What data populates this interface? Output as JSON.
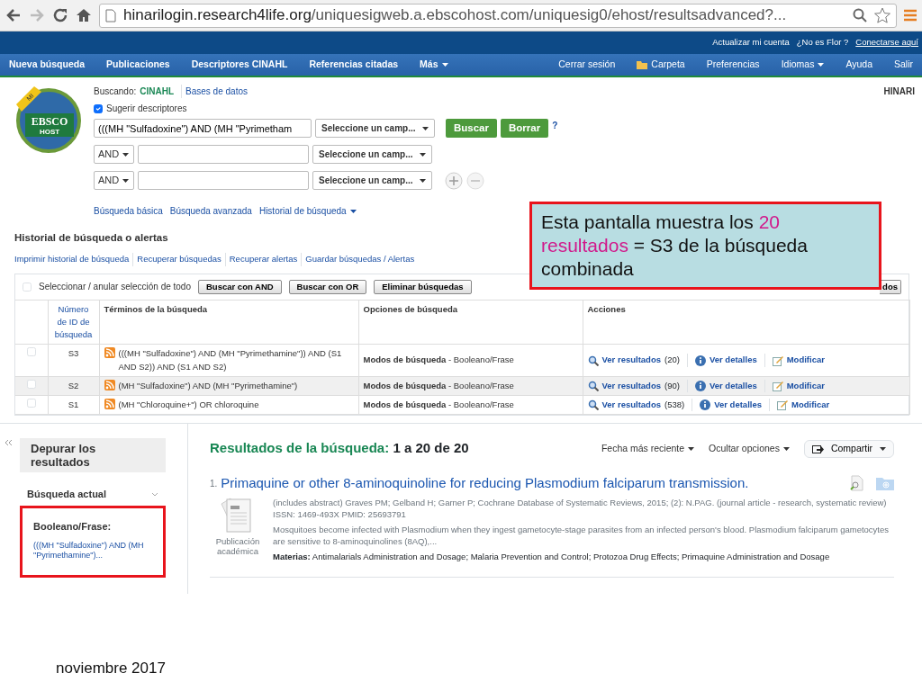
{
  "browser": {
    "url_host": "hinarilogin.research4life.org",
    "url_path": "/uniquesigweb.a.ebscohost.com/uniquesig0/ehost/resultsadvanced?..."
  },
  "top_links": [
    {
      "label": "Actualizar mi cuenta",
      "kind": "plain"
    },
    {
      "label": "¿No es Flor ?",
      "kind": "plain"
    },
    {
      "label": "Conectarse aquí",
      "kind": "underline"
    }
  ],
  "nav_left": [
    {
      "label": "Nueva búsqueda",
      "kind": "plain"
    },
    {
      "label": "Publicaciones",
      "kind": "plain"
    },
    {
      "label": "Descriptores CINAHL",
      "kind": "plain"
    },
    {
      "label": "Referencias citadas",
      "kind": "plain"
    },
    {
      "label": "Más",
      "kind": "dropdown"
    }
  ],
  "nav_right": [
    {
      "label": "Cerrar sesión",
      "kind": "plain"
    },
    {
      "label": "Carpeta",
      "kind": "folder"
    },
    {
      "label": "Preferencias",
      "kind": "plain"
    },
    {
      "label": "Idiomas",
      "kind": "dropdown"
    },
    {
      "label": "Ayuda",
      "kind": "plain"
    },
    {
      "label": "Salir",
      "kind": "plain"
    }
  ],
  "logo": {
    "ribbon": "MI",
    "name": "EBSCO",
    "sub": "HOST"
  },
  "institution": "HINARI",
  "search": {
    "searching_label": "Buscando:",
    "database": "CINAHL",
    "databases_link": "Bases de datos",
    "suggest": {
      "label": "Sugerir descriptores",
      "checked": true
    },
    "rows": [
      {
        "kind": "first",
        "value": "(((MH \"Sulfadoxine\") AND (MH \"Pyrimetham",
        "field": "Seleccione un camp..."
      },
      {
        "kind": "bool",
        "operator": "AND",
        "value": "",
        "field": "Seleccione un camp..."
      },
      {
        "kind": "bool",
        "operator": "AND",
        "value": "",
        "field": "Seleccione un camp..."
      }
    ],
    "search_button": "Buscar",
    "clear_button": "Borrar",
    "help": "?",
    "links": [
      {
        "label": "Búsqueda básica",
        "dropdown": false
      },
      {
        "label": "Búsqueda avanzada",
        "dropdown": false
      },
      {
        "label": "Historial de búsqueda",
        "dropdown": true
      }
    ]
  },
  "history": {
    "title": "Historial de búsqueda o alertas",
    "links": [
      "Imprimir historial de búsqueda",
      "Recuperar búsquedas",
      "Recuperar alertas",
      "Guardar búsquedas / Alertas"
    ],
    "select_all": {
      "label": "Seleccionar / anular selección de todo",
      "checked": false
    },
    "buttons": [
      "Buscar con AND",
      "Buscar con OR",
      "Eliminar búsquedas"
    ],
    "covered_button": "dos",
    "columns": [
      "Número de ID de búsqueda",
      "Términos de la búsqueda",
      "Opciones de búsqueda",
      "Acciones"
    ],
    "rows": [
      {
        "id": "S3",
        "terms": "(((MH \"Sulfadoxine\") AND (MH \"Pyrimethamine\")) AND (S1 AND S2)) AND (S1 AND S2)",
        "options_label": "Modos de búsqueda",
        "options_value": " - Booleano/Frase",
        "results": "Ver resultados",
        "count": "(20)",
        "details": "Ver detalles",
        "modify": "Modificar",
        "checked": false,
        "highlighted": false
      },
      {
        "id": "S2",
        "terms": "(MH \"Sulfadoxine\") AND (MH \"Pyrimethamine\")",
        "options_label": "Modos de búsqueda",
        "options_value": " - Booleano/Frase",
        "results": "Ver resultados",
        "count": "(90)",
        "details": "Ver detalles",
        "modify": "Modificar",
        "checked": false,
        "highlighted": true
      },
      {
        "id": "S1",
        "terms": "(MH \"Chloroquine+\") OR chloroquine",
        "options_label": "Modos de búsqueda",
        "options_value": " - Booleano/Frase",
        "results": "Ver resultados",
        "count": "(538)",
        "details": "Ver detalles",
        "modify": "Modificar",
        "checked": false,
        "highlighted": false
      }
    ]
  },
  "callout": {
    "parts": [
      {
        "text": "Esta pantalla muestra los ",
        "highlight": false
      },
      {
        "text": "20 resultados",
        "highlight": true
      },
      {
        "text": " = S3 de la búsqueda combinada",
        "highlight": false
      }
    ]
  },
  "sidebar": {
    "title": "Depurar los resultados",
    "section": "Búsqueda actual",
    "expanded": true,
    "mode_label": "Booleano/Frase:",
    "query": "(((MH \"Sulfadoxine\") AND (MH \"Pyrimethamine\")..."
  },
  "results": {
    "heading": "Resultados de la búsqueda:",
    "range": "1 a 20 de 20",
    "sort": "Fecha más reciente",
    "options": "Ocultar opciones",
    "share": "Compartir",
    "items": [
      {
        "number": "1.",
        "title": "Primaquine or other 8-aminoquinoline for reducing Plasmodium falciparum transmission.",
        "type": "Publicación académica",
        "citation": "(includes abstract) Graves PM; Gelband H; Garner P; Cochrane Database of Systematic Reviews, 2015; (2): N.PAG. (journal article - research, systematic review) ISSN: 1469-493X PMID: 25693791",
        "abstract": "Mosquitoes become infected with Plasmodium when they ingest gametocyte-stage parasites from an infected person's blood. Plasmodium falciparum gametocytes are sensitive to 8-aminoquinolines (8AQ),...",
        "subjects": "**Materias:** Antimalarials Administration and Dosage; Malaria Prevention and Control; Protozoa Drug Effects; Primaquine Administration and Dosage"
      }
    ]
  },
  "footer": "noviembre 2017"
}
